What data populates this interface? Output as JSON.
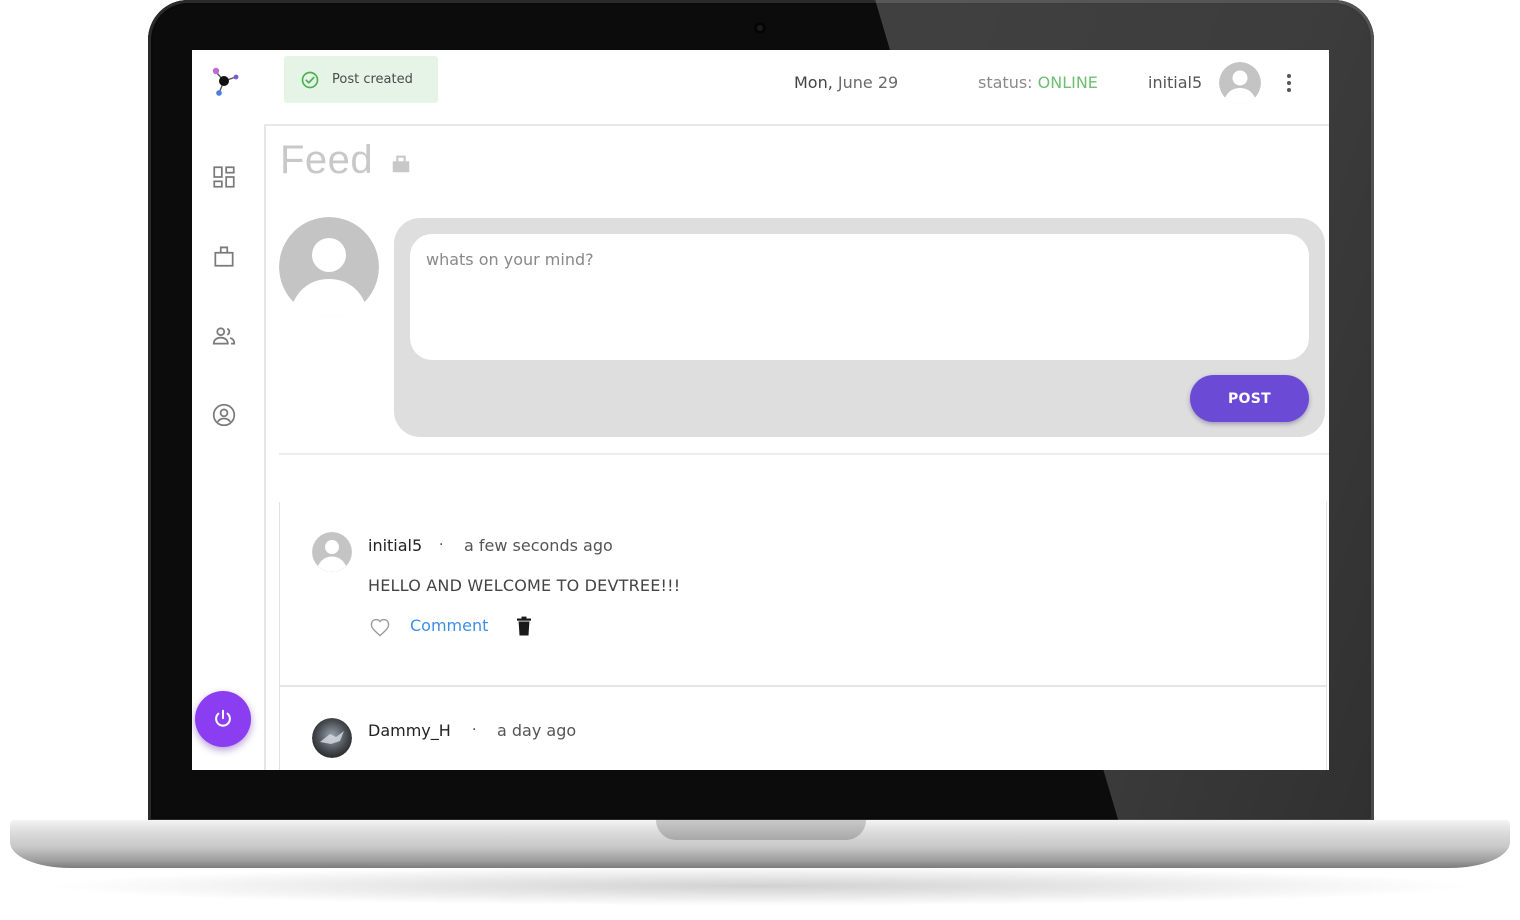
{
  "app": {
    "toast": {
      "text": "Post created",
      "icon": "check-circle-icon",
      "color": "#6fbf73"
    },
    "header": {
      "date_day": "Mon,",
      "date_rest": " June 29",
      "status_label": "status: ",
      "status_value": "ONLINE",
      "username": "initial5"
    },
    "sidebar": {
      "items": [
        {
          "icon": "dashboard-icon"
        },
        {
          "icon": "feed-icon"
        },
        {
          "icon": "people-icon"
        },
        {
          "icon": "account-circle-icon"
        }
      ],
      "logout_icon": "power-icon"
    },
    "page": {
      "title": "Feed",
      "title_icon": "feed-icon"
    },
    "composer": {
      "placeholder": "whats on your mind?",
      "post_label": "POST"
    },
    "posts": [
      {
        "author": "initial5",
        "separator": "·",
        "time": "a few seconds ago",
        "text": "HELLO AND WELCOME TO DEVTREE!!!",
        "comment_label": "Comment"
      },
      {
        "author": "Dammy_H",
        "separator": "·",
        "time": "a day ago"
      }
    ],
    "colors": {
      "accent": "#6b4bd6",
      "logout": "#8b3df2",
      "link": "#3b8fe8",
      "online": "#6fbf73"
    }
  }
}
